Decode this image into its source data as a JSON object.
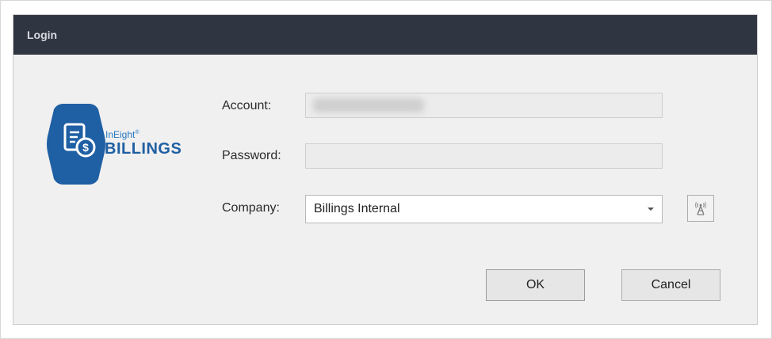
{
  "window": {
    "title": "Login"
  },
  "logo": {
    "brand_small": "InEight",
    "brand_reg": "®",
    "brand_big": "BILLINGS",
    "icon": "document-dollar-icon",
    "color": "#1f5fa3"
  },
  "form": {
    "account_label": "Account:",
    "account_value": "",
    "password_label": "Password:",
    "password_value": "",
    "company_label": "Company:",
    "company_value": "Billings Internal",
    "connection_icon": "antenna-tower-icon"
  },
  "buttons": {
    "ok_label": "OK",
    "cancel_label": "Cancel"
  },
  "colors": {
    "titlebar": "#2f3541",
    "dialog_bg": "#f0f0f0"
  }
}
